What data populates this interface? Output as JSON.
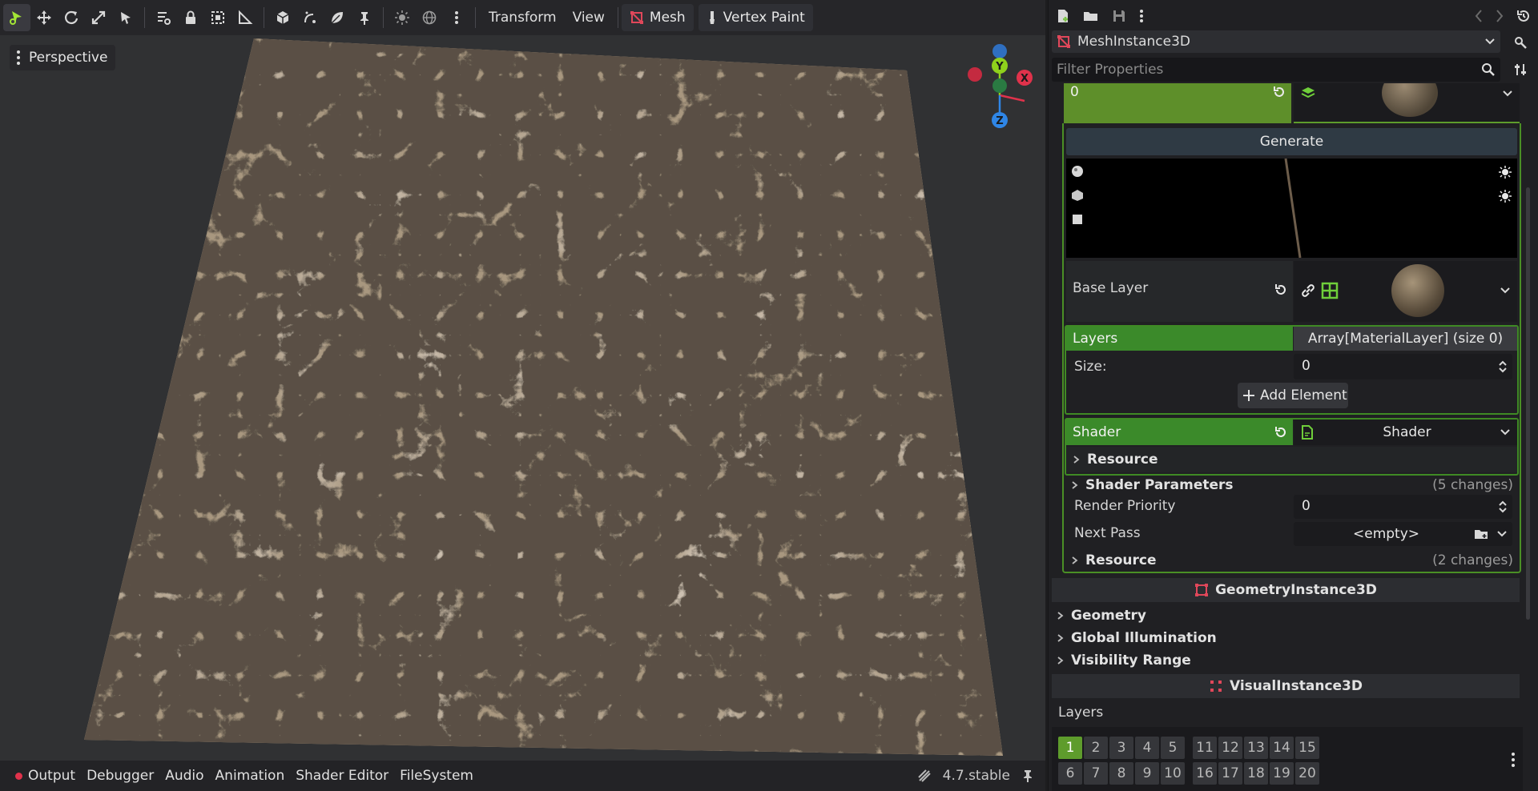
{
  "toolbar": {
    "menus": {
      "transform": "Transform",
      "view": "View",
      "mesh": "Mesh",
      "vertex_paint": "Vertex Paint"
    }
  },
  "viewport": {
    "perspective_label": "Perspective",
    "gizmo": {
      "y": "Y",
      "z": "Z",
      "x": "X"
    }
  },
  "bottom": {
    "output": "Output",
    "debugger": "Debugger",
    "audio": "Audio",
    "animation": "Animation",
    "shader_editor": "Shader Editor",
    "filesystem": "FileSystem",
    "version": "4.7.stable"
  },
  "inspector": {
    "node_name": "MeshInstance3D",
    "filter_placeholder": "Filter Properties",
    "top_value": "0",
    "generate_label": "Generate",
    "base_layer_label": "Base Layer",
    "layers_label": "Layers",
    "layers_value": "Array[MaterialLayer] (size 0)",
    "size_label": "Size:",
    "size_value": "0",
    "add_element_label": "Add Element",
    "shader_label": "Shader",
    "shader_value": "Shader",
    "resource_label": "Resource",
    "shader_params_label": "Shader Parameters",
    "shader_params_changes": "(5 changes)",
    "render_priority_label": "Render Priority",
    "render_priority_value": "0",
    "next_pass_label": "Next Pass",
    "next_pass_value": "<empty>",
    "resource2_label": "Resource",
    "resource2_changes": "(2 changes)",
    "geometry_instance_label": "GeometryInstance3D",
    "geometry_label": "Geometry",
    "gi_label": "Global Illumination",
    "visibility_range_label": "Visibility Range",
    "visual_instance_label": "VisualInstance3D",
    "vi_layers_label": "Layers",
    "layer_numbers": [
      "1",
      "2",
      "3",
      "4",
      "5",
      "11",
      "12",
      "13",
      "14",
      "15",
      "6",
      "7",
      "8",
      "9",
      "10",
      "16",
      "17",
      "18",
      "19",
      "20"
    ],
    "active_layer": "1"
  },
  "colors": {
    "accent_green": "#3b8a2a",
    "mesh_red": "#e0475a",
    "axis_x": "#e0324b",
    "axis_y": "#8fd11c",
    "axis_z": "#2f86e6"
  }
}
